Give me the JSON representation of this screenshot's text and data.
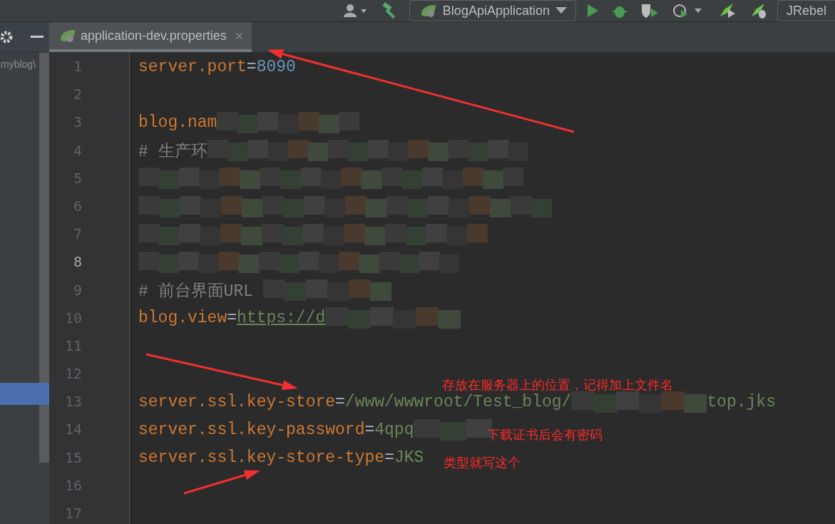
{
  "toolbar": {
    "run_config": "BlogApiApplication",
    "plugin_button": "JRebel"
  },
  "project_panel": {
    "path": "myblog\\"
  },
  "tabs": [
    {
      "label": "application-dev.properties",
      "selected": true,
      "close": "×"
    }
  ],
  "editor": {
    "lines": [
      {
        "number": "1",
        "current": false,
        "segments": [
          {
            "kind": "key",
            "text": "server.port"
          },
          {
            "kind": "op",
            "text": "="
          },
          {
            "kind": "number",
            "text": "8090"
          }
        ]
      },
      {
        "number": "2",
        "current": false
      },
      {
        "number": "3",
        "current": false,
        "segments": [
          {
            "kind": "key",
            "text": "blog.nam"
          },
          {
            "kind": "redacted"
          }
        ]
      },
      {
        "number": "4",
        "current": false,
        "segments": [
          {
            "kind": "comment",
            "text": "# 生产环"
          },
          {
            "kind": "redacted"
          }
        ]
      },
      {
        "number": "5",
        "current": false,
        "segments": [
          {
            "kind": "redacted"
          }
        ]
      },
      {
        "number": "6",
        "current": false,
        "segments": [
          {
            "kind": "redacted"
          }
        ]
      },
      {
        "number": "7",
        "current": false,
        "segments": [
          {
            "kind": "redacted"
          }
        ]
      },
      {
        "number": "8",
        "current": true,
        "segments": [
          {
            "kind": "redacted"
          }
        ]
      },
      {
        "number": "9",
        "current": false,
        "segments": [
          {
            "kind": "comment",
            "text": "# 前台界面URL "
          },
          {
            "kind": "redacted"
          }
        ]
      },
      {
        "number": "10",
        "current": false,
        "segments": [
          {
            "kind": "key",
            "text": "blog.view"
          },
          {
            "kind": "op",
            "text": "="
          },
          {
            "kind": "link",
            "text": "https://d"
          },
          {
            "kind": "redacted"
          }
        ]
      },
      {
        "number": "11",
        "current": false
      },
      {
        "number": "12",
        "current": false
      },
      {
        "number": "13",
        "current": false,
        "segments": [
          {
            "kind": "key",
            "text": "server.ssl.key-store"
          },
          {
            "kind": "op",
            "text": "="
          },
          {
            "kind": "value",
            "text": "/www/wwwroot/Test_blog/"
          },
          {
            "kind": "redacted"
          },
          {
            "kind": "value",
            "text": "top.jks"
          }
        ]
      },
      {
        "number": "14",
        "current": false,
        "segments": [
          {
            "kind": "key",
            "text": "server.ssl.key-password"
          },
          {
            "kind": "op",
            "text": "="
          },
          {
            "kind": "value",
            "text": "4qpq"
          },
          {
            "kind": "redacted"
          }
        ]
      },
      {
        "number": "15",
        "current": false,
        "segments": [
          {
            "kind": "key",
            "text": "server.ssl.key-store-type"
          },
          {
            "kind": "op",
            "text": "="
          },
          {
            "kind": "value",
            "text": "JKS"
          }
        ]
      },
      {
        "number": "16",
        "current": false
      },
      {
        "number": "17",
        "current": false
      }
    ]
  },
  "annotations": [
    {
      "text": "存放在服务器上的位置，记得加上文件名"
    },
    {
      "text": "下载证书后会有密码"
    },
    {
      "text": "类型就写这个"
    }
  ]
}
